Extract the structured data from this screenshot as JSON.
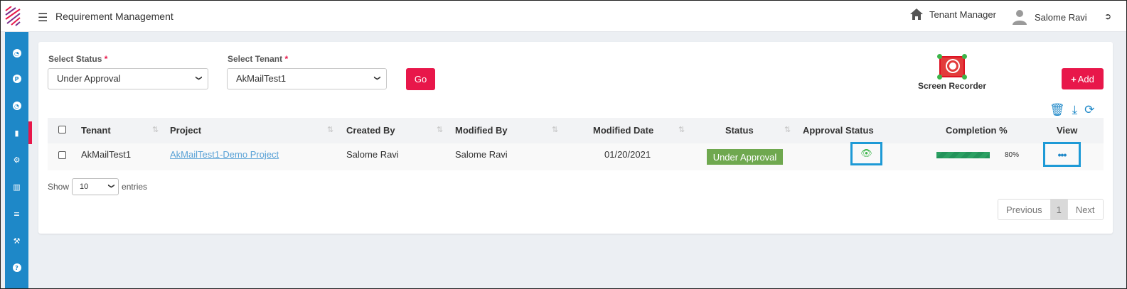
{
  "header": {
    "title": "Requirement Management",
    "tenant_manager_label": "Tenant Manager",
    "user_name": "Salome Ravi"
  },
  "sidebar": {
    "items": [
      {
        "icon": "chart-pie-icon",
        "active": false
      },
      {
        "icon": "p-circle-icon",
        "active": false
      },
      {
        "icon": "dashboard-icon",
        "active": false
      },
      {
        "icon": "book-icon",
        "active": true
      },
      {
        "icon": "gears-icon",
        "active": false
      },
      {
        "icon": "sitemap-icon",
        "active": false
      },
      {
        "icon": "sliders-icon",
        "active": false
      },
      {
        "icon": "wrench-icon",
        "active": false
      },
      {
        "icon": "help-icon",
        "active": false
      }
    ]
  },
  "filters": {
    "status_label": "Select Status",
    "status_value": "Under Approval",
    "tenant_label": "Select Tenant",
    "tenant_value": "AkMailTest1",
    "required_mark": "*",
    "go_label": "Go"
  },
  "recorder": {
    "label": "Screen Recorder"
  },
  "add_button": {
    "label": "Add"
  },
  "table": {
    "columns": [
      "Tenant",
      "Project",
      "Created By",
      "Modified By",
      "Modified Date",
      "Status",
      "Approval Status",
      "Completion %",
      "View"
    ],
    "rows": [
      {
        "tenant": "AkMailTest1",
        "project": "AkMailTest1-Demo Project",
        "created_by": "Salome Ravi",
        "modified_by": "Salome Ravi",
        "modified_date": "01/20/2021",
        "status": "Under Approval",
        "completion": 0.8,
        "completion_label": "80%"
      }
    ]
  },
  "length_menu": {
    "show": "Show",
    "value": "10",
    "entries": "entries"
  },
  "pagination": {
    "previous": "Previous",
    "current": "1",
    "next": "Next"
  },
  "colors": {
    "accent": "#e8174a",
    "sidebar": "#1e88c8",
    "status_badge": "#6fa84f",
    "progress": "#2ba062"
  }
}
